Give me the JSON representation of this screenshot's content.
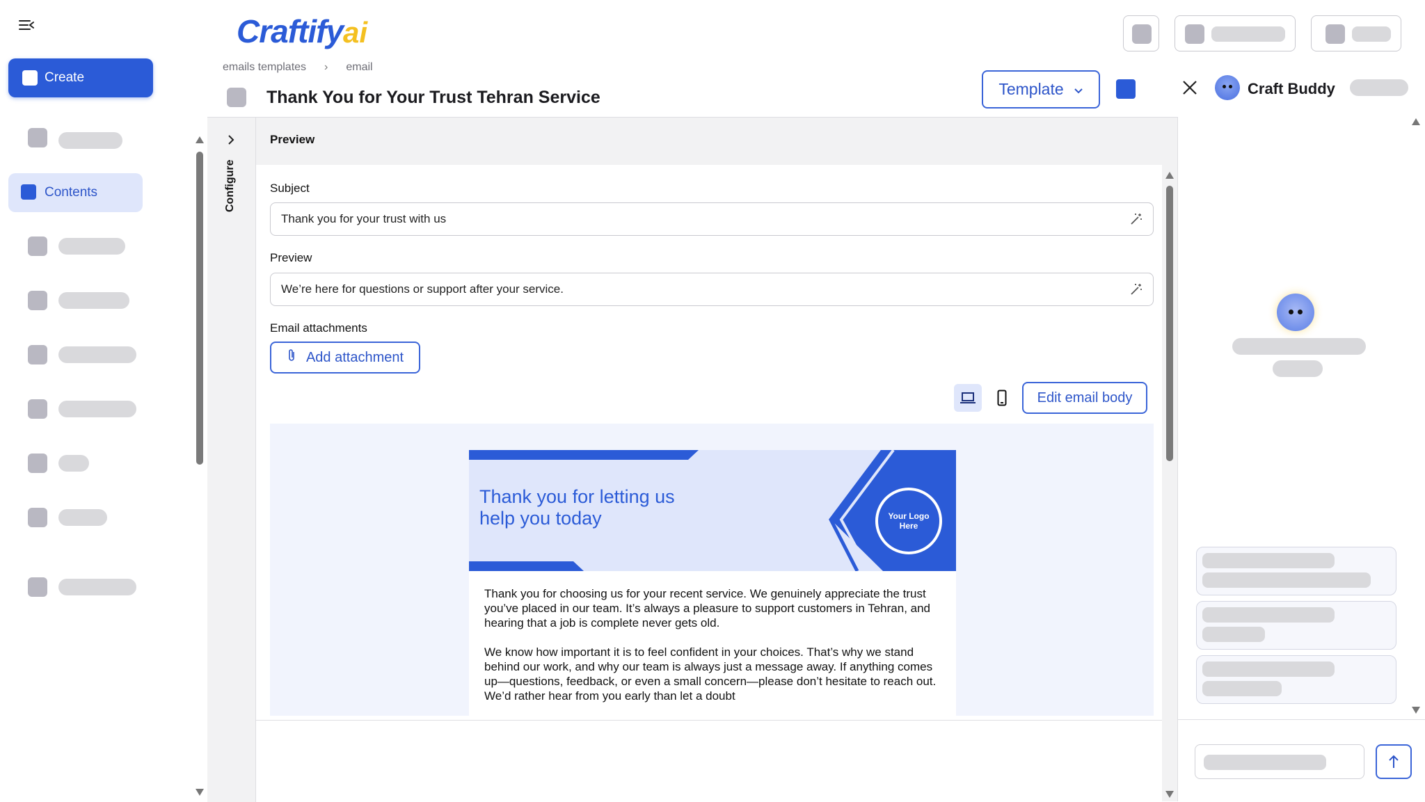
{
  "app": {
    "logo_text": "Craftify",
    "logo_suffix": "ai",
    "colors": {
      "brand": "#2b5bd7",
      "accent": "#f4c021",
      "active_bg": "#dfe6fb"
    }
  },
  "sidebar": {
    "menu_icon": "menu-collapse-icon",
    "create_label": "Create",
    "contents_label": "Contents"
  },
  "breadcrumb": {
    "items": [
      "emails templates",
      "email"
    ]
  },
  "header": {
    "title": "Thank You for Your Trust Tehran Service",
    "template_button": "Template"
  },
  "config": {
    "tab_label": "Configure"
  },
  "editor": {
    "section_title": "Preview",
    "subject_label": "Subject",
    "subject_value": "Thank you for your trust with us",
    "preview_label": "Preview",
    "preview_value": "We’re here for questions or support after your service.",
    "attachments_label": "Email attachments",
    "add_attachment": "Add attachment",
    "edit_body": "Edit email body"
  },
  "email_preview": {
    "banner_heading_line1": "Thank you for letting us",
    "banner_heading_line2": "help you today",
    "logo_line1": "Your Logo",
    "logo_line2": "Here",
    "paragraph1": "Thank you for choosing us for your recent service. We genuinely appreciate the trust you’ve placed in our team. It’s always a pleasure to support customers in Tehran, and hearing that a job is complete never gets old.",
    "paragraph2": "We know how important it is to feel confident in your choices. That’s why we stand behind our work, and why our team is always just a message away. If anything comes up—questions, feedback, or even a small concern—please don’t hesitate to reach out. We’d rather hear from you early than let a doubt"
  },
  "buddy": {
    "title": "Craft Buddy"
  }
}
